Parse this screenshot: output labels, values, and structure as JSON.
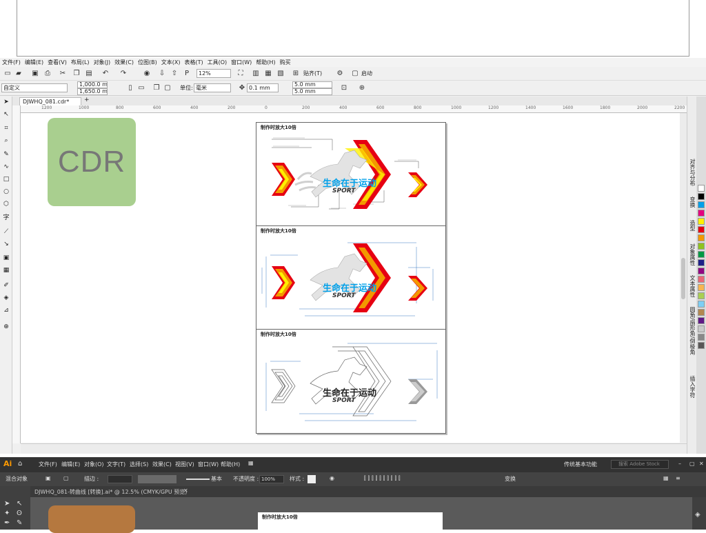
{
  "cdr": {
    "menu": [
      "文件(F)",
      "编辑(E)",
      "查看(V)",
      "布局(L)",
      "对象(J)",
      "效果(C)",
      "位图(B)",
      "文本(X)",
      "表格(T)",
      "工具(O)",
      "窗口(W)",
      "帮助(H)",
      "购买"
    ],
    "toolbar": {
      "zoom": "12%",
      "snap_label": "贴齐(T)",
      "launch_label": "启动"
    },
    "props": {
      "page_size": "自定义",
      "width": "1,000.0 mm",
      "height": "1,650.0 mm",
      "unit_label": "单位:",
      "unit": "毫米",
      "nudge": "0.1 mm",
      "dup_x": "5.0 mm",
      "dup_y": "5.0 mm"
    },
    "doc_tab": "DJWHQ_081.cdr*",
    "ruler_ticks": [
      "1200",
      "1000",
      "800",
      "600",
      "400",
      "200",
      "0",
      "200",
      "400",
      "600",
      "800",
      "1000",
      "1200",
      "1400",
      "1600",
      "1800",
      "2000",
      "2200"
    ],
    "logo_text": "CDR",
    "panels": [
      {
        "title": "制作时放大10倍"
      },
      {
        "title": "制作时放大10倍"
      },
      {
        "title": "制作时放大10倍"
      }
    ],
    "artwork": {
      "chinese": "生命在于运动",
      "sport": "SPORT"
    },
    "dock": [
      "对齐与分布",
      "变换",
      "造型",
      "对象属性",
      "文本属性",
      "圆角/扇形角/倒棱角",
      "插入字符"
    ],
    "palette": [
      "#ffffff",
      "#000000",
      "#00a0e9",
      "#e4007f",
      "#fff100",
      "#e60012",
      "#f39800",
      "#8fc31f",
      "#009944",
      "#1d2088",
      "#920783",
      "#eb6877",
      "#f8b551",
      "#aacf53",
      "#7ecef4",
      "#b28850",
      "#601986",
      "#c9caca",
      "#898989",
      "#595757"
    ]
  },
  "ai": {
    "logo": "Ai",
    "menu": [
      "文件(F)",
      "编辑(E)",
      "对象(O)",
      "文字(T)",
      "选择(S)",
      "效果(C)",
      "视图(V)",
      "窗口(W)",
      "帮助(H)"
    ],
    "workspace": "传统基本功能",
    "search_placeholder": "搜索 Adobe Stock",
    "control": {
      "mixed_objects": "混合对象",
      "stroke_label": "描边 :",
      "basic": "基本",
      "opacity_label": "不透明度 :",
      "opacity": "100%",
      "style_label": "样式 :",
      "transform": "变换"
    },
    "doc_tab": "DJWHQ_081-转曲线 [转换].ai* @ 12.5% (CMYK/GPU 预览)",
    "page_title": "制作时放大10倍"
  }
}
